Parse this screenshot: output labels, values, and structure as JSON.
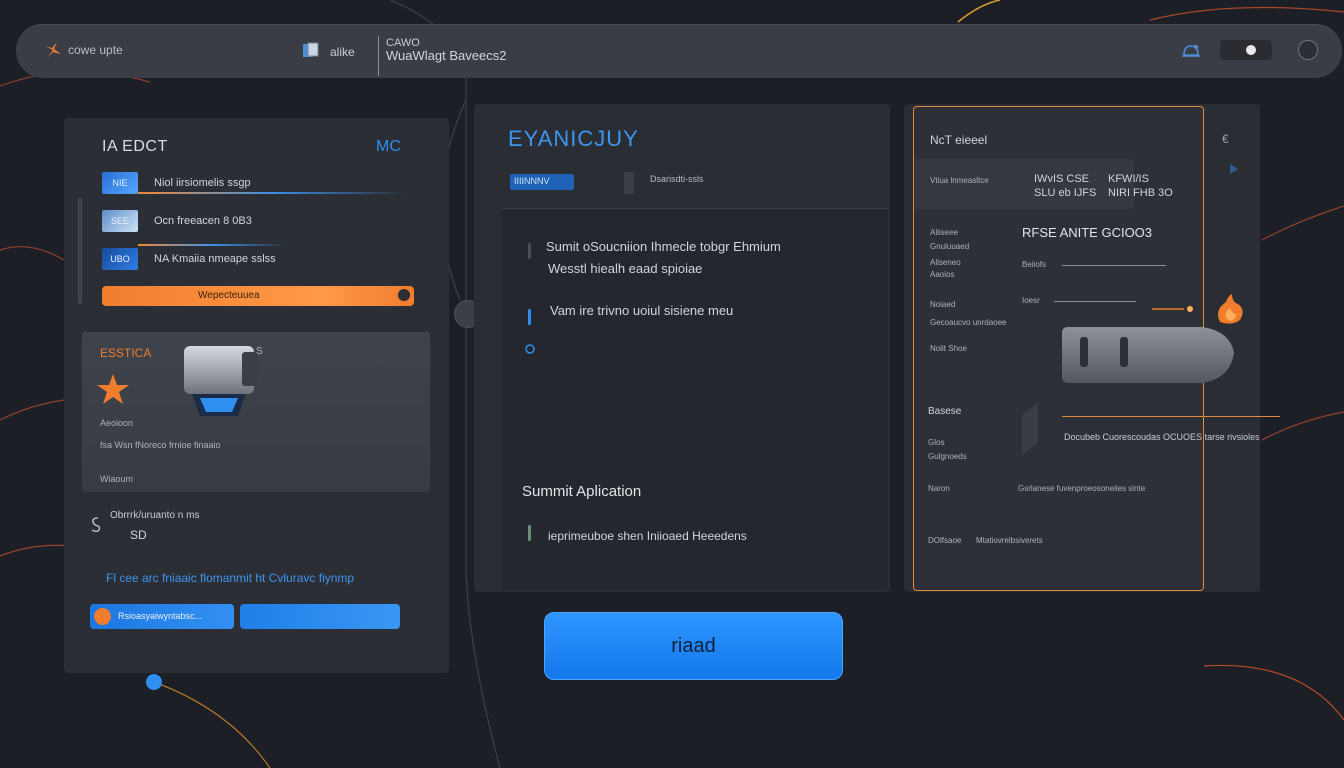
{
  "topbar": {
    "brand": "cowe upte",
    "workspace": "alike",
    "title": "CAWO",
    "subtitle": "WuaWlagt Baveecs2"
  },
  "left_panel": {
    "title": "IA EDCT",
    "title_right": "MC",
    "list": [
      {
        "thumb": "NIE",
        "label": "Niol iirsiomelis ssgp"
      },
      {
        "thumb": "SEE",
        "label": "Ocn freeacen 8 0B3"
      },
      {
        "thumb": "UBO",
        "label": "NA Kmaiia nmeape  sslss"
      }
    ],
    "progress_label": "Wepecteuuea",
    "card": {
      "title": "ESSTICA",
      "badge": "S",
      "caption": "Aeoioon",
      "meta": "fsa   Wsn  fNoreco  frnioe    finaaio",
      "footer": "Wiaoum"
    },
    "sub_info": "Obrrrk/uruanto  n ms",
    "sub_value": "SD",
    "note": "Fl cee arc fniaaic flomanmit ht Cvluravc fiynmp",
    "button_primary": "Rsioasyaiwyntabsc..."
  },
  "center_panel": {
    "title": "EYANICJUY",
    "chip": "IIIINNNV",
    "tag": "Dsarisdti-ssls",
    "lines": [
      "Sumit oSoucniion Ihmecle tobgr Ehmium",
      "Wesstl hiealh eaad spioiae",
      "Vam ire trivno uoiul sisiene meu"
    ],
    "heading": "Summit Aplication",
    "footer_line": "ieprimeuboe shen Iniioaed Heeedens",
    "read_button": "riaad"
  },
  "right_panel": {
    "title": "NcT eieeel",
    "side_label": "€",
    "header_cols": [
      {
        "small": "Vtiua lnmeasltce",
        "a": "IWvIS CSE",
        "b": "KFWI/IS"
      },
      {
        "small": "",
        "a": "SLU eb  IJFS",
        "b": "NIRI FHB 3O"
      }
    ],
    "big_value": "RFSE  ANITE  GCIOO3",
    "rows": [
      {
        "label": "Aliiseee",
        "sub": "Gnuluuaed",
        "value": "Beiiofs"
      },
      {
        "label": "Aliseneo",
        "sub": "",
        "value": "Aaoios"
      },
      {
        "label": "Noiaed",
        "sub": "Gecoaucvo unrdaoee",
        "value": ""
      },
      {
        "label": "Nolit  Shoe",
        "sub": "",
        "value": "Ioesr"
      }
    ],
    "section": "Basese",
    "section_rows": [
      {
        "label": "Glos",
        "sub": "Gulgnoeds"
      },
      {
        "label": "Naron",
        "sub": "Gsrlanese fuvenproeosoneiies sinte"
      },
      {
        "label": "DOlfsaoe",
        "sub": "Mtatiovrelbsiverets"
      }
    ],
    "right_text": "Docubeb  Cuorescoudas OCUOES tarse rivsioles"
  },
  "colors": {
    "accent_blue": "#2f8ff0",
    "accent_orange": "#f07d2e",
    "panel": "#2b2e35",
    "background": "#1c1f26"
  }
}
